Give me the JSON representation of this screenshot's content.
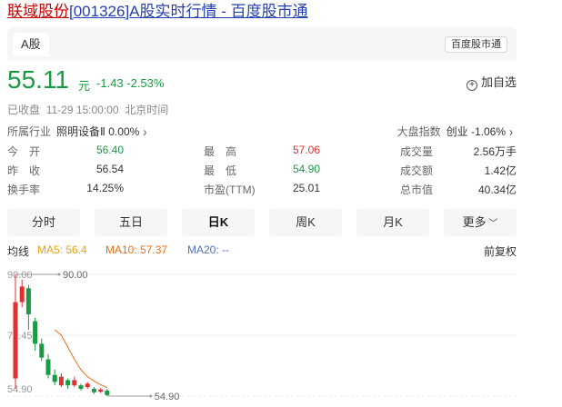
{
  "header": {
    "stock_name": "联域股份",
    "title_rest": "[001326]A股实时行情 - 百度股市通"
  },
  "tabs": {
    "market": "A股",
    "source": "百度股市通"
  },
  "quote": {
    "price": "55.11",
    "unit": "元",
    "change": "-1.43",
    "change_pct": "-2.53%",
    "watch_label": "加自选",
    "status": "已收盘",
    "time": "11-29 15:00:00",
    "zone": "北京时间"
  },
  "industry": {
    "label": "所属行业",
    "value": "照明设备Ⅱ 0.00%"
  },
  "index": {
    "label": "大盘指数",
    "value": "创业 -1.06%"
  },
  "stats": [
    [
      {
        "label": "今　开",
        "value": "56.40",
        "tone": "green"
      },
      {
        "label": "最　高",
        "value": "57.06",
        "tone": "red"
      },
      {
        "label": "成交量",
        "value": "2.56万手",
        "tone": ""
      }
    ],
    [
      {
        "label": "昨　收",
        "value": "56.54",
        "tone": ""
      },
      {
        "label": "最　低",
        "value": "54.90",
        "tone": "green"
      },
      {
        "label": "成交额",
        "value": "1.42亿",
        "tone": ""
      }
    ],
    [
      {
        "label": "换手率",
        "value": "14.25%",
        "tone": ""
      },
      {
        "label": "市盈(TTM)",
        "value": "25.01",
        "tone": ""
      },
      {
        "label": "总市值",
        "value": "40.34亿",
        "tone": ""
      }
    ]
  ],
  "periods": [
    "分时",
    "五日",
    "日K",
    "周K",
    "月K",
    "更多"
  ],
  "active_period": "日K",
  "ma": {
    "label": "均线",
    "ma5": "MA5: 56.4",
    "ma10": "MA10: 57.37",
    "ma20": "MA20: --",
    "adjust": "前复权"
  },
  "colors": {
    "up": "#e03131",
    "down": "#1a9a45",
    "ma5": "#e8a317",
    "ma10": "#e8701a",
    "ma20": "#5470c6",
    "link": "#2440b3"
  },
  "chart_data": {
    "type": "candlestick",
    "y_labels": [
      "90.00",
      "72.45",
      "54.90"
    ],
    "high_marker": "90.00",
    "low_marker": "54.90",
    "ylim": [
      54.9,
      90.0
    ],
    "candles": [
      {
        "o": 60.0,
        "c": 82.0,
        "h": 90.0,
        "l": 57.0
      },
      {
        "o": 82.0,
        "c": 86.5,
        "h": 88.5,
        "l": 80.5
      },
      {
        "o": 86.0,
        "c": 78.5,
        "h": 87.0,
        "l": 74.0
      },
      {
        "o": 76.5,
        "c": 70.0,
        "h": 77.5,
        "l": 68.0
      },
      {
        "o": 70.0,
        "c": 66.0,
        "h": 71.5,
        "l": 65.0
      },
      {
        "o": 65.5,
        "c": 61.0,
        "h": 67.0,
        "l": 60.0
      },
      {
        "o": 61.0,
        "c": 59.0,
        "h": 62.5,
        "l": 58.0
      },
      {
        "o": 58.0,
        "c": 60.5,
        "h": 61.5,
        "l": 57.5
      },
      {
        "o": 59.5,
        "c": 58.0,
        "h": 60.0,
        "l": 57.0
      },
      {
        "o": 58.0,
        "c": 59.5,
        "h": 60.5,
        "l": 57.5
      },
      {
        "o": 58.0,
        "c": 57.0,
        "h": 58.5,
        "l": 56.5
      },
      {
        "o": 57.5,
        "c": 58.5,
        "h": 59.0,
        "l": 57.0
      },
      {
        "o": 57.0,
        "c": 56.0,
        "h": 57.5,
        "l": 55.5
      },
      {
        "o": 56.2,
        "c": 56.8,
        "h": 57.2,
        "l": 55.8
      },
      {
        "o": 56.5,
        "c": 55.2,
        "h": 57.0,
        "l": 54.9
      }
    ],
    "ma10_line": [
      null,
      null,
      null,
      null,
      null,
      null,
      74.0,
      72.5,
      69.0,
      65.5,
      62.5,
      60.5,
      59.2,
      58.2,
      57.37
    ]
  }
}
